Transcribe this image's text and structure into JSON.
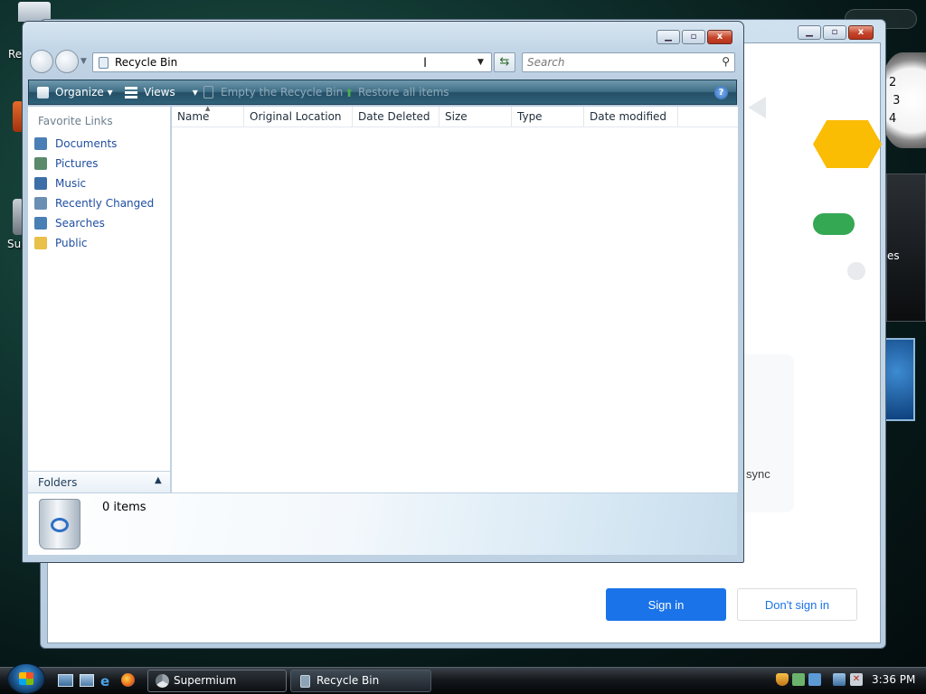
{
  "desktop": {
    "icons": [
      {
        "label": "Re"
      },
      {
        "label": "Sup"
      }
    ]
  },
  "background_window": {
    "title": "",
    "sync_text": "sync",
    "signin_label": "Sign in",
    "nosignin_label": "Don't sign in",
    "gadget_text": "es"
  },
  "explorer": {
    "address": "Recycle Bin",
    "search_placeholder": "Search",
    "toolbar": {
      "organize": "Organize",
      "views": "Views",
      "empty": "Empty the Recycle Bin",
      "restore": "Restore all items"
    },
    "favorite_links_title": "Favorite Links",
    "favorites": [
      {
        "label": "Documents",
        "icon": "documents-icon",
        "color": "#4a7fb5"
      },
      {
        "label": "Pictures",
        "icon": "pictures-icon",
        "color": "#5a8a6a"
      },
      {
        "label": "Music",
        "icon": "music-icon",
        "color": "#3d6ea8"
      },
      {
        "label": "Recently Changed",
        "icon": "recent-icon",
        "color": "#6b8fb3"
      },
      {
        "label": "Searches",
        "icon": "searches-icon",
        "color": "#4a7fb5"
      },
      {
        "label": "Public",
        "icon": "public-folder-icon",
        "color": "#e8c04a"
      }
    ],
    "folders_label": "Folders",
    "columns": [
      "Name",
      "Original Location",
      "Date Deleted",
      "Size",
      "Type",
      "Date modified"
    ],
    "status": "0 items"
  },
  "taskbar": {
    "tasks": [
      {
        "label": "Supermium",
        "icon": "supermium-icon"
      },
      {
        "label": "Recycle Bin",
        "icon": "recycle-bin-icon"
      }
    ],
    "clock": "3:36 PM"
  },
  "colors": {
    "accent": "#1a73e8",
    "link": "#1f4ea0"
  }
}
